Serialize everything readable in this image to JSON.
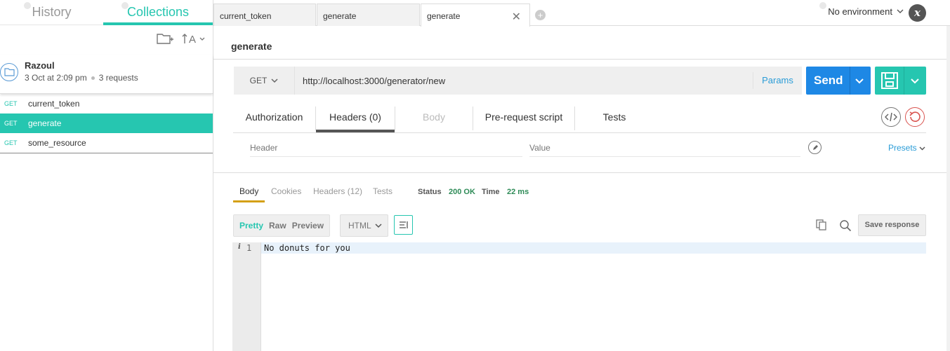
{
  "sidebar": {
    "tabs": [
      {
        "label": "History",
        "active": false
      },
      {
        "label": "Collections",
        "active": true
      }
    ],
    "tools": {
      "new_folder_icon": "folder-plus-icon",
      "sort_icon": "sort-alpha-icon"
    },
    "collection": {
      "name": "Razoul",
      "date": "3 Oct at 2:09 pm",
      "count": "3 requests"
    },
    "requests": [
      {
        "method": "GET",
        "name": "current_token",
        "active": false
      },
      {
        "method": "GET",
        "name": "generate",
        "active": true
      },
      {
        "method": "GET",
        "name": "some_resource",
        "active": false
      }
    ]
  },
  "tabbar": {
    "tabs": [
      {
        "label": "current_token"
      },
      {
        "label": "generate"
      },
      {
        "label": "generate",
        "active": true
      }
    ],
    "environment": "No environment"
  },
  "request": {
    "title": "generate",
    "method": "GET",
    "url": "http://localhost:3000/generator/new",
    "params_label": "Params",
    "send_label": "Send",
    "tabs": [
      {
        "label": "Authorization"
      },
      {
        "label": "Headers (0)",
        "active": true
      },
      {
        "label": "Body",
        "disabled": true
      },
      {
        "label": "Pre-request script"
      },
      {
        "label": "Tests"
      }
    ],
    "header_placeholder": "Header",
    "value_placeholder": "Value",
    "presets_label": "Presets"
  },
  "response": {
    "tabs": [
      {
        "label": "Body",
        "active": true
      },
      {
        "label": "Cookies"
      },
      {
        "label": "Headers (12)"
      },
      {
        "label": "Tests"
      }
    ],
    "status_label": "Status",
    "status_value": "200 OK",
    "time_label": "Time",
    "time_value": "22 ms",
    "view_modes": [
      {
        "label": "Pretty",
        "active": true
      },
      {
        "label": "Raw"
      },
      {
        "label": "Preview"
      }
    ],
    "format": "HTML",
    "save_label": "Save response",
    "lines": [
      {
        "number": "1",
        "text": "No donuts for you"
      }
    ]
  },
  "colors": {
    "accent": "#26c6b0",
    "send": "#1e88e5",
    "link": "#2a9cd7",
    "status_ok": "#2e8b57",
    "tab_underline": "#d4a017"
  }
}
